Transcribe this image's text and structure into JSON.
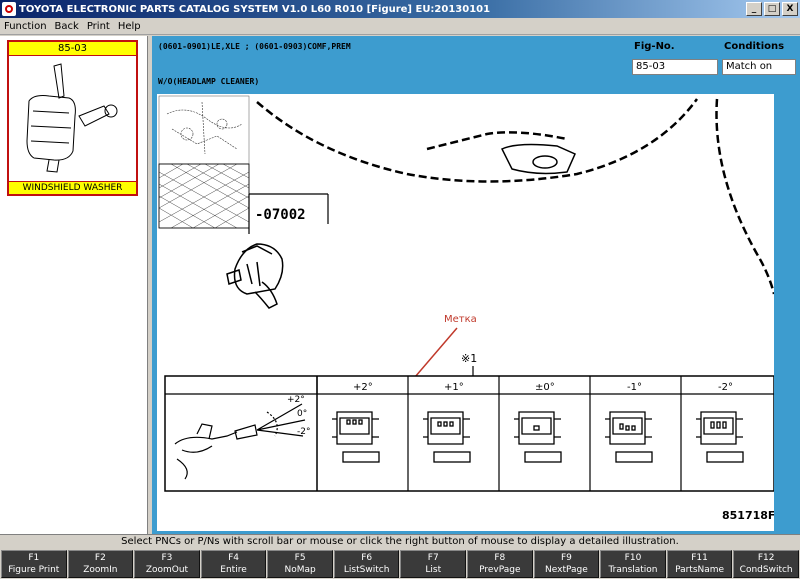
{
  "window": {
    "title": "TOYOTA ELECTRONIC PARTS CATALOG SYSTEM V1.0 L60 R010 [Figure] EU:20130101",
    "min_glyph": "_",
    "max_glyph": "□",
    "close_glyph": "X"
  },
  "menu": [
    "Function",
    "Back",
    "Print",
    "Help"
  ],
  "thumbnail": {
    "fig_no": "85-03",
    "caption": "WINDSHIELD WASHER"
  },
  "header": {
    "codes_line": "(0601-0901)LE,XLE ;  (0601-0903)COMF,PREM",
    "condition_line": "W/O(HEADLAMP CLEANER)",
    "fig_no_label": "Fig-No.",
    "fig_no_value": "85-03",
    "conditions_label": "Conditions",
    "conditions_value": "Match on"
  },
  "figure": {
    "part_number": "-07002",
    "annotation": "Метка",
    "note_ref": "※1",
    "angle_columns": [
      "+2°",
      "+1°",
      "±0°",
      "-1°",
      "-2°"
    ],
    "nozzle_angles": [
      "+2°",
      "0°",
      "-2°"
    ],
    "illustration_id": "851718F"
  },
  "status": "Select PNCs or P/Ns with scroll bar or mouse or click the right button of mouse to display a detailed illustration.",
  "fkeys": [
    {
      "key": "F1",
      "label": "Figure Print"
    },
    {
      "key": "F2",
      "label": "ZoomIn"
    },
    {
      "key": "F3",
      "label": "ZoomOut"
    },
    {
      "key": "F4",
      "label": "Entire"
    },
    {
      "key": "F5",
      "label": "NoMap"
    },
    {
      "key": "F6",
      "label": "ListSwitch"
    },
    {
      "key": "F7",
      "label": "List"
    },
    {
      "key": "F8",
      "label": "PrevPage"
    },
    {
      "key": "F9",
      "label": "NextPage"
    },
    {
      "key": "F10",
      "label": "Translation"
    },
    {
      "key": "F11",
      "label": "PartsName"
    },
    {
      "key": "F12",
      "label": "CondSwitch"
    }
  ]
}
